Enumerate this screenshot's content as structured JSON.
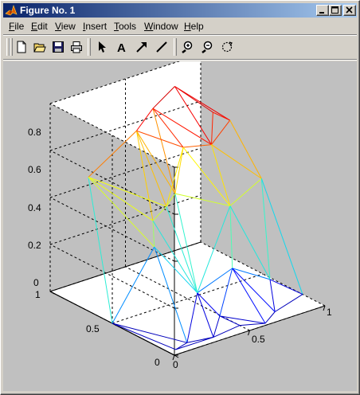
{
  "window": {
    "title": "Figure No. 1"
  },
  "menu": [
    {
      "pre": "",
      "u": "F",
      "post": "ile"
    },
    {
      "pre": "",
      "u": "E",
      "post": "dit"
    },
    {
      "pre": "",
      "u": "V",
      "post": "iew"
    },
    {
      "pre": "",
      "u": "I",
      "post": "nsert"
    },
    {
      "pre": "",
      "u": "T",
      "post": "ools"
    },
    {
      "pre": "",
      "u": "W",
      "post": "indow"
    },
    {
      "pre": "",
      "u": "H",
      "post": "elp"
    }
  ],
  "toolbar": {
    "icons": [
      "new-file-icon",
      "open-folder-icon",
      "save-icon",
      "print-icon",
      "select-arrow-icon",
      "insert-text-icon",
      "insert-arrow-icon",
      "insert-line-icon",
      "zoom-in-icon",
      "zoom-out-icon",
      "rotate-3d-icon"
    ],
    "text_tool_label": "A"
  },
  "axes": {
    "z_ticks": [
      "0.8",
      "0.6",
      "0.4",
      "0.2",
      "0"
    ],
    "y_ticks": [
      "1",
      "0.5",
      "0"
    ],
    "x_ticks": [
      "0",
      "0.5",
      "1"
    ]
  },
  "chart_data": {
    "type": "trisurf",
    "zlim": [
      0,
      0.8
    ],
    "xlim": [
      0,
      1
    ],
    "ylim": [
      0,
      1
    ],
    "grid": "on",
    "box": "on",
    "colormap": "jet",
    "colormap_stops": [
      "#0000bb",
      "#0000ff",
      "#00c8ff",
      "#40ffc0",
      "#c0ff40",
      "#ffff00",
      "#ff8000",
      "#ff0000",
      "#b00000"
    ],
    "vertices": [
      {
        "x": 0.0,
        "y": 0.5,
        "z": 0.0
      },
      {
        "x": 0.13,
        "y": 0.85,
        "z": 0.5
      },
      {
        "x": 0.18,
        "y": 0.38,
        "z": 0.32
      },
      {
        "x": 0.15,
        "y": 0.08,
        "z": 0.0
      },
      {
        "x": 0.5,
        "y": 0.08,
        "z": 0.0
      },
      {
        "x": 0.62,
        "y": 0.02,
        "z": 0.0
      },
      {
        "x": 0.3,
        "y": 0.05,
        "z": 0.0
      },
      {
        "x": 0.05,
        "y": 0.05,
        "z": 0.0
      },
      {
        "x": 0.4,
        "y": 0.3,
        "z": 0.1
      },
      {
        "x": 0.4,
        "y": 0.12,
        "z": 0.05
      },
      {
        "x": 0.27,
        "y": 0.5,
        "z": 0.38
      },
      {
        "x": 0.4,
        "y": 0.55,
        "z": 0.4
      },
      {
        "x": 0.45,
        "y": 0.85,
        "z": 0.63
      },
      {
        "x": 0.6,
        "y": 0.9,
        "z": 0.68
      },
      {
        "x": 0.77,
        "y": 0.93,
        "z": 0.73
      },
      {
        "x": 0.85,
        "y": 0.72,
        "z": 0.66
      },
      {
        "x": 0.93,
        "y": 0.68,
        "z": 0.62
      },
      {
        "x": 0.62,
        "y": 0.68,
        "z": 0.57
      },
      {
        "x": 0.95,
        "y": 0.45,
        "z": 0.43
      },
      {
        "x": 0.7,
        "y": 0.4,
        "z": 0.38
      },
      {
        "x": 0.55,
        "y": 0.2,
        "z": 0.2
      },
      {
        "x": 0.8,
        "y": 0.2,
        "z": 0.1
      },
      {
        "x": 1.0,
        "y": 0.18,
        "z": 0.0
      },
      {
        "x": 0.75,
        "y": 0.1,
        "z": 0.0
      },
      {
        "x": 0.7,
        "y": 0.55,
        "z": 0.6
      },
      {
        "x": 0.5,
        "y": 0.6,
        "z": 0.42
      }
    ],
    "triangles": [
      [
        0,
        1,
        2
      ],
      [
        0,
        2,
        3
      ],
      [
        0,
        3,
        7
      ],
      [
        1,
        10,
        2
      ],
      [
        1,
        12,
        10
      ],
      [
        1,
        11,
        12
      ],
      [
        2,
        10,
        8
      ],
      [
        2,
        8,
        3
      ],
      [
        3,
        8,
        6
      ],
      [
        3,
        6,
        7
      ],
      [
        6,
        8,
        9
      ],
      [
        6,
        9,
        4
      ],
      [
        4,
        9,
        5
      ],
      [
        9,
        8,
        20
      ],
      [
        9,
        20,
        5
      ],
      [
        10,
        11,
        8
      ],
      [
        11,
        25,
        8
      ],
      [
        11,
        12,
        25
      ],
      [
        12,
        13,
        25
      ],
      [
        12,
        17,
        13
      ],
      [
        13,
        14,
        24
      ],
      [
        13,
        24,
        17
      ],
      [
        14,
        15,
        24
      ],
      [
        14,
        16,
        15
      ],
      [
        15,
        16,
        24
      ],
      [
        16,
        18,
        24
      ],
      [
        24,
        18,
        19
      ],
      [
        24,
        19,
        17
      ],
      [
        17,
        19,
        25
      ],
      [
        25,
        19,
        8
      ],
      [
        8,
        19,
        20
      ],
      [
        19,
        21,
        20
      ],
      [
        19,
        18,
        21
      ],
      [
        18,
        22,
        21
      ],
      [
        21,
        22,
        23
      ],
      [
        21,
        23,
        20
      ],
      [
        20,
        23,
        5
      ],
      [
        17,
        11,
        25
      ]
    ]
  }
}
